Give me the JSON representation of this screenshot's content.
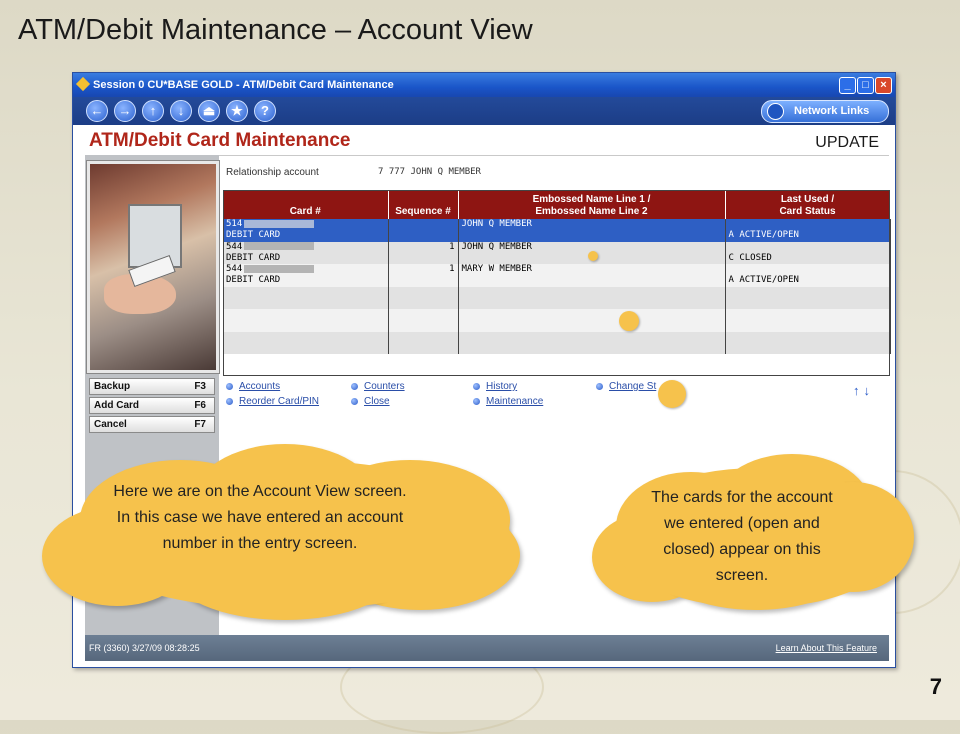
{
  "slide": {
    "title": "ATM/Debit Maintenance – Account View",
    "page_number": "7"
  },
  "window": {
    "title": "Session 0 CU*BASE GOLD - ATM/Debit Card Maintenance",
    "min": "_",
    "max": "□",
    "close": "×"
  },
  "navbar": {
    "buttons": [
      "←",
      "→",
      "↑",
      "↓",
      "⏏",
      "★",
      "?"
    ],
    "network_links": "Network Links"
  },
  "header": {
    "title": "ATM/Debit Card Maintenance",
    "mode": "UPDATE"
  },
  "relationship": {
    "label": "Relationship account",
    "value": "7 777 JOHN Q MEMBER"
  },
  "table": {
    "headers": {
      "card": "Card #",
      "sequence": "Sequence #",
      "name_line1": "Embossed Name Line 1 /",
      "name_line2": "Embossed Name Line 2",
      "status_line1": "Last Used /",
      "status_line2": "Card Status"
    },
    "rows": [
      {
        "card": "514",
        "card_type": "DEBIT CARD",
        "sequence": "",
        "name": "JOHN Q MEMBER",
        "status": "A  ACTIVE/OPEN"
      },
      {
        "card": "544",
        "card_type": "DEBIT CARD",
        "sequence": "1",
        "name": "JOHN Q MEMBER",
        "status": "C  CLOSED"
      },
      {
        "card": "544",
        "card_type": "DEBIT CARD",
        "sequence": "1",
        "name": "MARY W MEMBER",
        "status": "A  ACTIVE/OPEN"
      }
    ]
  },
  "function_keys": [
    {
      "label": "Backup",
      "key": "F3"
    },
    {
      "label": "Add Card",
      "key": "F6"
    },
    {
      "label": "Cancel",
      "key": "F7"
    }
  ],
  "links": {
    "accounts": "Accounts",
    "reorder": "Reorder Card/PIN",
    "counters": "Counters",
    "close": "Close",
    "history": "History",
    "maintenance": "Maintenance",
    "change_status": "Change St"
  },
  "scroll_arrows": "↑↓",
  "status_bar": {
    "left": "FR (3360) 3/27/09 08:28:25",
    "right": "Learn About This Feature"
  },
  "callouts": {
    "left": "Here we are on the Account View screen.  In this case we have entered an account number in the entry screen.",
    "right": "The cards for the account we entered (open and closed) appear on this screen."
  },
  "colors": {
    "accent_red": "#b0261a",
    "header_red": "#8e1512",
    "selected_blue": "#2e5fc4",
    "callout_yellow": "#f6c24c"
  }
}
